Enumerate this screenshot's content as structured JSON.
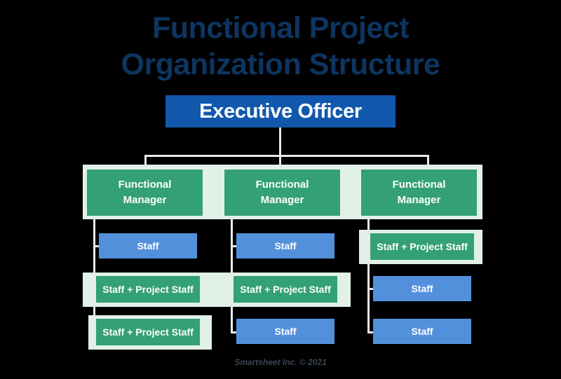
{
  "title": {
    "line1": "Functional Project",
    "line2": "Organization Structure"
  },
  "root": {
    "label": "Executive Officer"
  },
  "columns": [
    {
      "manager": "Functional Manager",
      "manager_line1": "Functional",
      "manager_line2": "Manager",
      "reports": [
        {
          "label": "Staff",
          "type": "staff"
        },
        {
          "label": "Staff + Project Staff",
          "type": "project"
        },
        {
          "label": "Staff + Project Staff",
          "type": "project"
        }
      ]
    },
    {
      "manager": "Functional Manager",
      "manager_line1": "Functional",
      "manager_line2": "Manager",
      "reports": [
        {
          "label": "Staff",
          "type": "staff"
        },
        {
          "label": "Staff + Project Staff",
          "type": "project"
        },
        {
          "label": "Staff",
          "type": "staff"
        }
      ]
    },
    {
      "manager": "Functional Manager",
      "manager_line1": "Functional",
      "manager_line2": "Manager",
      "reports": [
        {
          "label": "Staff + Project Staff",
          "type": "project"
        },
        {
          "label": "Staff",
          "type": "staff"
        },
        {
          "label": "Staff",
          "type": "staff"
        }
      ]
    }
  ],
  "footer": "Smartsheet Inc. © 2021",
  "colors": {
    "background": "#000000",
    "title": "#0d3560",
    "executive": "#1158ad",
    "manager_green": "#34a077",
    "staff_blue": "#5390dc",
    "project_green": "#34a077",
    "highlight_band": "#e2f1e8",
    "connector": "#e8eaec",
    "footer_text": "#3c4654"
  }
}
